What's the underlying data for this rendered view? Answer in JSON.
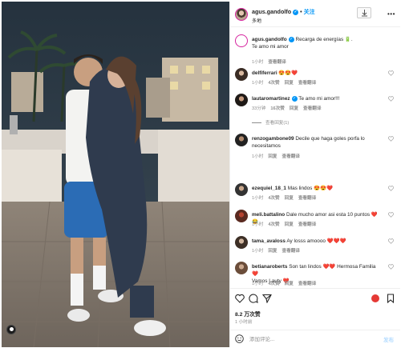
{
  "header": {
    "username": "agus.gandolfo",
    "follow_label": "关注",
    "subtitle": "多地",
    "separator": "•"
  },
  "caption": {
    "username": "agus.gandolfo",
    "text_line1": "Recarga de energías 🔋.",
    "text_line2": "Te amo mi amor",
    "time": "1小时",
    "translate": "查看翻译"
  },
  "comments": [
    {
      "user": "delfiferrari",
      "text": "😍😍❤️",
      "time": "1小时",
      "likes": "4次赞",
      "reply": "回复",
      "translate": "查看翻译",
      "view_replies": ""
    },
    {
      "user": "lautaromartinez",
      "text": "Te amo mi amor!!!",
      "time": "33分钟",
      "likes": "16次赞",
      "reply": "回复",
      "translate": "查看翻译",
      "view_replies": "查看回复(1)"
    },
    {
      "user": "renzogambone09",
      "text": "Decile que haga goles porfa lo necesitamos",
      "time": "1小时",
      "likes": "",
      "reply": "回复",
      "translate": "查看翻译",
      "view_replies": ""
    },
    {
      "user": "ezequiel_18_1",
      "text": "Mas lindos 😍😍❤️",
      "time": "1小时",
      "likes": "4次赞",
      "reply": "回复",
      "translate": "查看翻译",
      "view_replies": ""
    },
    {
      "user": "meli.battalino",
      "text": "Dale mucho amor asi esta 10 puntos ❤️😂",
      "time": "1小时",
      "likes": "4次赞",
      "reply": "回复",
      "translate": "查看翻译",
      "view_replies": ""
    },
    {
      "user": "tama_avaloss",
      "text": "Ay losss amoooo ❤️❤️❤️",
      "time": "1小时",
      "likes": "",
      "reply": "回复",
      "translate": "查看翻译",
      "view_replies": ""
    },
    {
      "user": "betianaroberts",
      "text_a": "Son tan lindos ❤️❤️ Hermosa Familia❤️",
      "text_b": "Vamos Lauty ❤️",
      "time": "1小时",
      "likes": "4次赞",
      "reply": "回复",
      "translate": "查看翻译",
      "view_replies": ""
    }
  ],
  "actions": {
    "likes": "8.2 万次赞",
    "time": "1 小时前"
  },
  "comment_input": {
    "placeholder": "添加评论...",
    "post_label": "发布"
  },
  "colors": {
    "accent": "#0095f6",
    "heart": "#e11d2c",
    "muted": "#8e8e8e"
  }
}
